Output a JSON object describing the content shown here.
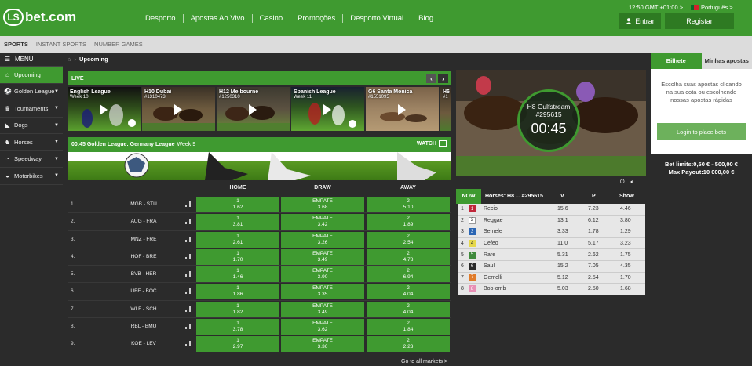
{
  "brand": {
    "logo_mark": "LS",
    "logo_text": "bet.com"
  },
  "nav": [
    "Desporto",
    "Apostas Ao Vivo",
    "Casino",
    "Promoções",
    "Desporto Virtual",
    "Blog"
  ],
  "header": {
    "clock": "12:50 GMT +01:00 >",
    "language": "Português >",
    "login_label": "Entrar",
    "register_label": "Registar"
  },
  "subnav": [
    "SPORTS",
    "INSTANT SPORTS",
    "NUMBER GAMES"
  ],
  "sidebar": {
    "menu_label": "MENU",
    "items": [
      {
        "label": "Upcoming",
        "icon": "home-icon",
        "active": true
      },
      {
        "label": "Golden League",
        "icon": "football-icon"
      },
      {
        "label": "Tournaments",
        "icon": "trophy-icon"
      },
      {
        "label": "Dogs",
        "icon": "dog-icon"
      },
      {
        "label": "Horses",
        "icon": "horse-icon"
      },
      {
        "label": "Speedway",
        "icon": "speedway-icon"
      },
      {
        "label": "Motorbikes",
        "icon": "motorbike-icon"
      }
    ]
  },
  "breadcrumb": {
    "current": "Upcoming"
  },
  "live": {
    "label": "LIVE",
    "events": [
      {
        "name": "English League",
        "sub": "Week 10",
        "kind": "football"
      },
      {
        "name": "H10 Dubai",
        "sub": "#1310473",
        "kind": "horse"
      },
      {
        "name": "H12 Melbourne",
        "sub": "#1250310",
        "kind": "horse"
      },
      {
        "name": "Spanish League",
        "sub": "Week 11",
        "kind": "football"
      },
      {
        "name": "G6 Santa Monica",
        "sub": "#1551095",
        "kind": "dog"
      },
      {
        "name": "H6",
        "sub": "#1",
        "kind": "horse"
      }
    ]
  },
  "event": {
    "time_title": "00:45 Golden League: Germany League",
    "week": "Week 9",
    "watch_label": "WATCH"
  },
  "columns": {
    "home": "HOME",
    "draw": "DRAW",
    "away": "AWAY"
  },
  "matches": [
    {
      "no": "1.",
      "teams": "MGB - STU",
      "home": [
        "1",
        "1.62"
      ],
      "draw": [
        "EMPATE",
        "3.68"
      ],
      "away": [
        "2",
        "5.10"
      ]
    },
    {
      "no": "2.",
      "teams": "AUG - FRA",
      "home": [
        "1",
        "3.81"
      ],
      "draw": [
        "EMPATE",
        "3.42"
      ],
      "away": [
        "2",
        "1.89"
      ]
    },
    {
      "no": "3.",
      "teams": "MNZ - FRE",
      "home": [
        "1",
        "2.61"
      ],
      "draw": [
        "EMPATE",
        "3.26"
      ],
      "away": [
        "2",
        "2.54"
      ]
    },
    {
      "no": "4.",
      "teams": "HOF - BRE",
      "home": [
        "1",
        "1.70"
      ],
      "draw": [
        "EMPATE",
        "3.49"
      ],
      "away": [
        "2",
        "4.78"
      ]
    },
    {
      "no": "5.",
      "teams": "BVB - HER",
      "home": [
        "1",
        "1.46"
      ],
      "draw": [
        "EMPATE",
        "3.90"
      ],
      "away": [
        "2",
        "6.94"
      ]
    },
    {
      "no": "6.",
      "teams": "UBE - BOC",
      "home": [
        "1",
        "1.86"
      ],
      "draw": [
        "EMPATE",
        "3.35"
      ],
      "away": [
        "2",
        "4.04"
      ]
    },
    {
      "no": "7.",
      "teams": "WLF - SCH",
      "home": [
        "1",
        "1.82"
      ],
      "draw": [
        "EMPATE",
        "3.49"
      ],
      "away": [
        "2",
        "4.04"
      ]
    },
    {
      "no": "8.",
      "teams": "RBL - BMU",
      "home": [
        "1",
        "3.78"
      ],
      "draw": [
        "EMPATE",
        "3.62"
      ],
      "away": [
        "2",
        "1.84"
      ]
    },
    {
      "no": "9.",
      "teams": "KOE - LEV",
      "home": [
        "1",
        "2.97"
      ],
      "draw": [
        "EMPATE",
        "3.36"
      ],
      "away": [
        "2",
        "2.23"
      ]
    }
  ],
  "goto_all": "Go to all markets >",
  "race": {
    "timer_title": "H8 Gulfstream",
    "timer_id": "#295615",
    "countdown": "00:45",
    "now_label": "NOW",
    "race_title": "Horses: H8 ... #295615",
    "cols": {
      "v": "V",
      "p": "P",
      "show": "Show"
    },
    "runners": [
      {
        "no": "1",
        "color": "#c0273a",
        "name": "Recio",
        "v": "15.6",
        "p": "7.23",
        "s": "4.46"
      },
      {
        "no": "2",
        "color": "#ffffff",
        "name": "Reggae",
        "v": "13.1",
        "p": "6.12",
        "s": "3.80"
      },
      {
        "no": "3",
        "color": "#2b66b4",
        "name": "Semele",
        "v": "3.33",
        "p": "1.78",
        "s": "1.29"
      },
      {
        "no": "4",
        "color": "#e6d84a",
        "name": "Cefeo",
        "v": "11.0",
        "p": "5.17",
        "s": "3.23"
      },
      {
        "no": "5",
        "color": "#3f8a3c",
        "name": "Rare",
        "v": "5.31",
        "p": "2.62",
        "s": "1.75"
      },
      {
        "no": "6",
        "color": "#2a2a2a",
        "name": "Saul",
        "v": "15.2",
        "p": "7.05",
        "s": "4.35"
      },
      {
        "no": "7",
        "color": "#e07b2a",
        "name": "Gemelli",
        "v": "5.12",
        "p": "2.54",
        "s": "1.70"
      },
      {
        "no": "8",
        "color": "#e88fb5",
        "name": "Bob-omb",
        "v": "5.03",
        "p": "2.50",
        "s": "1.68"
      }
    ]
  },
  "betslip": {
    "tab1": "Bilhete",
    "tab2": "Minhas apostas",
    "message": "Escolha suas apostas clicando na sua cota ou escolhendo nossas apostas rápidas",
    "login_button": "Login to place bets",
    "limits": "Bet limits:0,50 € - 500,00 €",
    "max_payout": "Max Payout:10 000,00 €"
  }
}
